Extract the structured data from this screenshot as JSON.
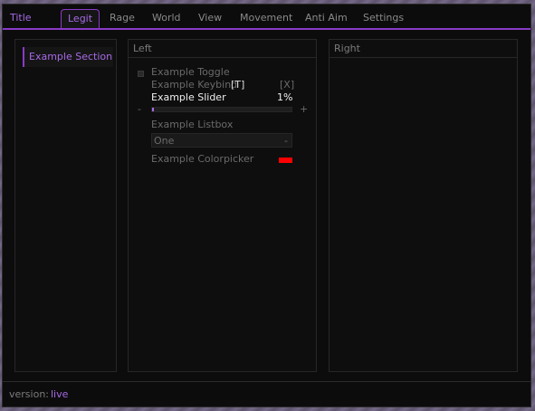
{
  "window": {
    "title": "Title"
  },
  "tabs": [
    {
      "label": "Legit",
      "active": true
    },
    {
      "label": "Rage"
    },
    {
      "label": "World"
    },
    {
      "label": "View"
    },
    {
      "label": "Movement"
    },
    {
      "label": "Anti Aim"
    },
    {
      "label": "Settings"
    }
  ],
  "sections": [
    {
      "label": "Example Section",
      "active": true
    }
  ],
  "left_panel": {
    "title": "Left",
    "toggle": {
      "label": "Example Toggle",
      "checked": false
    },
    "keybind": {
      "label": "Example Keybind",
      "key": "[T]",
      "clear": "[X]"
    },
    "slider": {
      "label": "Example Slider",
      "value_text": "1%",
      "value_percent": 1,
      "minus": "-",
      "plus": "+"
    },
    "listbox": {
      "label": "Example Listbox",
      "selected": "One",
      "arrow": "-"
    },
    "colorpicker": {
      "label": "Example Colorpicker",
      "color": "#ff0000"
    }
  },
  "right_panel": {
    "title": "Right"
  },
  "footer": {
    "version_label": "version:",
    "version_value": "live"
  },
  "colors": {
    "accent": "#a66ae6",
    "accent_line": "#8a3ac8",
    "background": "#0c0c0c",
    "text_dim": "#7b7b7b",
    "text_bright": "#ffffff"
  }
}
